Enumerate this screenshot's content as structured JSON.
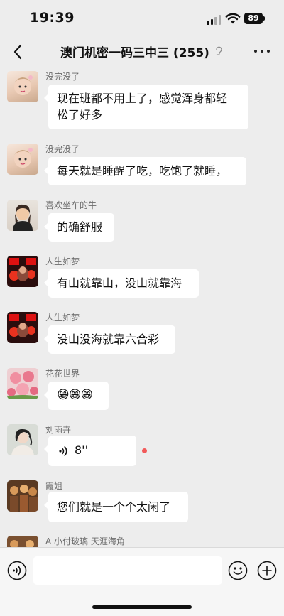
{
  "status": {
    "time": "19:39",
    "battery": "89"
  },
  "header": {
    "title": "澳门机密一码三中三 (255)"
  },
  "messages": [
    {
      "sender": "没完没了",
      "text": "现在班都不用上了，感觉浑身都轻",
      "text2": "松了好多"
    },
    {
      "sender": "没完没了",
      "text": "每天就是睡醒了吃，吃饱了就睡，"
    },
    {
      "sender": "喜欢坐车的牛",
      "text": "的确舒服"
    },
    {
      "sender": "人生如梦",
      "text": "有山就靠山，没山就靠海"
    },
    {
      "sender": "人生如梦",
      "text": "没山没海就靠六合彩"
    },
    {
      "sender": "花花世界",
      "text": "😁😁😁"
    },
    {
      "sender": "刘雨卉",
      "voice_duration": "8''"
    },
    {
      "sender": "霞姐",
      "text": "您们就是一个个太闲了"
    },
    {
      "sender": "A 小付玻璃 天涯海角"
    }
  ],
  "icons": {
    "back": "chevron-left-icon",
    "mute": "ear-icon",
    "more": "more-dots-icon",
    "voice": "voice-input-icon",
    "emoji": "emoji-icon",
    "plus": "plus-icon"
  }
}
